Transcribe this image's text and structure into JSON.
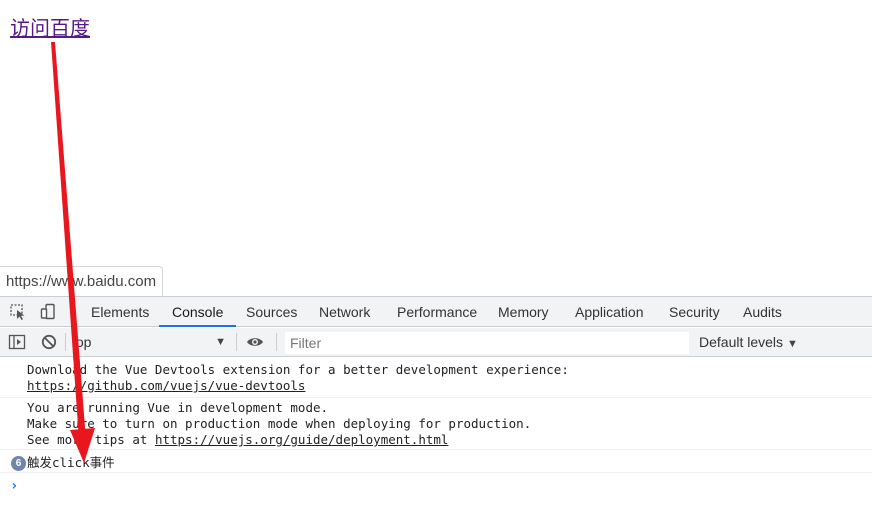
{
  "page": {
    "link_text": "访问百度",
    "status_url": "https://www.baidu.com"
  },
  "devtools": {
    "tabs": [
      {
        "label": "Elements"
      },
      {
        "label": "Console"
      },
      {
        "label": "Sources"
      },
      {
        "label": "Network"
      },
      {
        "label": "Performance"
      },
      {
        "label": "Memory"
      },
      {
        "label": "Application"
      },
      {
        "label": "Security"
      },
      {
        "label": "Audits"
      }
    ],
    "active_tab": "Console",
    "toolbar": {
      "context": "top",
      "filter_placeholder": "Filter",
      "levels": "Default levels"
    },
    "console": {
      "messages": [
        {
          "lines": [
            "Download the Vue Devtools extension for a better development experience:"
          ],
          "link": "https://github.com/vuejs/vue-devtools"
        },
        {
          "lines": [
            "You are running Vue in development mode.",
            "Make sure to turn on production mode when deploying for production."
          ],
          "prefix": "See more tips at ",
          "link": "https://vuejs.org/guide/deployment.html"
        },
        {
          "count": "6",
          "text": "触发click事件"
        }
      ],
      "prompt": "›"
    }
  },
  "colors": {
    "annotation_arrow": "#e8161d",
    "active_tab_underline": "#1a73e8",
    "visited_link": "#551a8b"
  }
}
